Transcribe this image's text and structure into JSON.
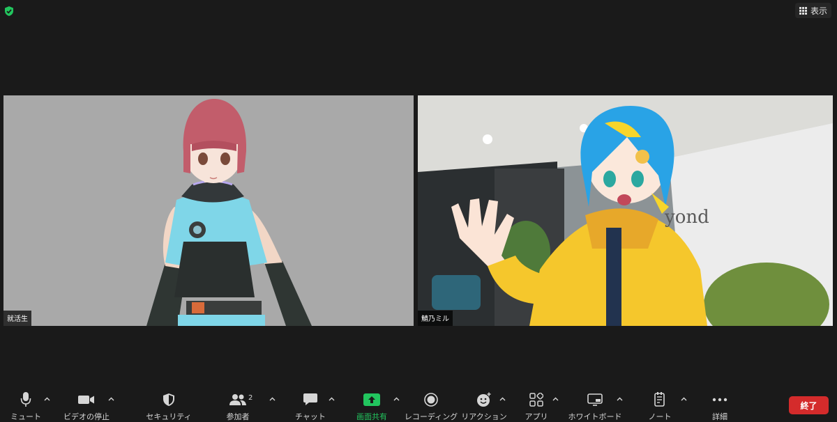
{
  "header": {
    "view_label": "表示"
  },
  "participants": [
    {
      "name": "就活生"
    },
    {
      "name": "鯖乃ミル"
    }
  ],
  "right_tile": {
    "wall_sign": "yond"
  },
  "toolbar": {
    "mute": "ミュート",
    "stop_video": "ビデオの停止",
    "security": "セキュリティ",
    "participants": "参加者",
    "participants_count": "2",
    "chat": "チャット",
    "share_screen": "画面共有",
    "recording": "レコーディング",
    "reactions": "リアクション",
    "apps": "アプリ",
    "whiteboard": "ホワイトボード",
    "notes": "ノート",
    "more": "詳細",
    "end": "終了"
  },
  "colors": {
    "background": "#1a1a1a",
    "share_green": "#22c55e",
    "end_red": "#d42b2b",
    "security_green": "#22c55e"
  }
}
